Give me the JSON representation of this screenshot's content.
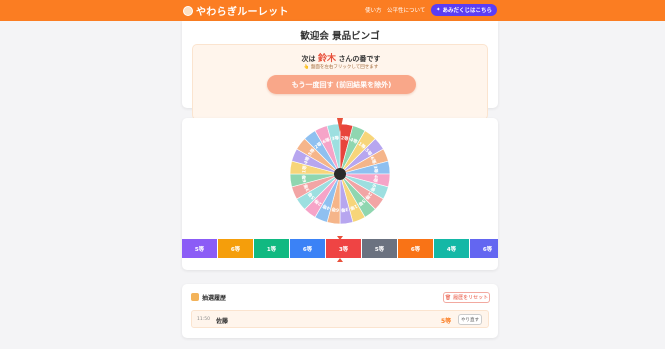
{
  "header": {
    "app_title": "やわらぎルーレット",
    "nav": [
      {
        "label": "使い方"
      },
      {
        "label": "公平性について"
      }
    ],
    "amida_label": "あみだくじはこちら",
    "colors": {
      "bar": "#fb7d22",
      "amida": "#5b3df5"
    }
  },
  "event": {
    "title": "歓迎会 景品ビンゴ",
    "turn_prefix": "次は",
    "turn_name": "鈴木",
    "turn_suffix": "さんの番です",
    "hint": "👆 盤面を左右フリックして回せます",
    "respin_label": "もう一度回す (前回結果を除外)"
  },
  "wheel": {
    "segments": [
      {
        "label": "2等",
        "color": "#f2a5a5"
      },
      {
        "label": "4等",
        "color": "#8fd6b0"
      },
      {
        "label": "1等",
        "color": "#f7d57a"
      },
      {
        "label": "5等",
        "color": "#b7a6ef"
      },
      {
        "label": "6等",
        "color": "#f5b58a"
      },
      {
        "label": "3等",
        "color": "#8fc0f0"
      },
      {
        "label": "4等",
        "color": "#f6a4c8"
      },
      {
        "label": "6等",
        "color": "#9ddfe0"
      },
      {
        "label": "2等",
        "color": "#f2a5a5"
      },
      {
        "label": "5等",
        "color": "#8fd6b0"
      },
      {
        "label": "1等",
        "color": "#f7d57a"
      },
      {
        "label": "3等",
        "color": "#b7a6ef"
      },
      {
        "label": "6等",
        "color": "#f5b58a"
      },
      {
        "label": "4等",
        "color": "#8fc0f0"
      },
      {
        "label": "2等",
        "color": "#f6a4c8"
      },
      {
        "label": "5等",
        "color": "#9ddfe0"
      },
      {
        "label": "3等",
        "color": "#f2a5a5"
      },
      {
        "label": "6等",
        "color": "#8fd6b0"
      },
      {
        "label": "1等",
        "color": "#f7d57a"
      },
      {
        "label": "4等",
        "color": "#b7a6ef"
      },
      {
        "label": "5等",
        "color": "#f5b58a"
      },
      {
        "label": "2等",
        "color": "#8fc0f0"
      },
      {
        "label": "6等",
        "color": "#f6a4c8"
      },
      {
        "label": "3等",
        "color": "#9ddfe0"
      }
    ],
    "selected_label": "3等",
    "selected_color": "#e8453c",
    "pointer_color": "#e8503a"
  },
  "strip": {
    "tiles": [
      {
        "label": "5等",
        "color": "#8b5cf6"
      },
      {
        "label": "6等",
        "color": "#f59e0b"
      },
      {
        "label": "1等",
        "color": "#10b981"
      },
      {
        "label": "6等",
        "color": "#3b82f6"
      },
      {
        "label": "3等",
        "color": "#ef4444"
      },
      {
        "label": "5等",
        "color": "#6b7280"
      },
      {
        "label": "6等",
        "color": "#f97316"
      },
      {
        "label": "4等",
        "color": "#14b8a6"
      },
      {
        "label": "6等",
        "color": "#6366f1"
      }
    ]
  },
  "history": {
    "title": "抽選履歴",
    "reset_label": "履歴をリセット",
    "rows": [
      {
        "time": "11:50",
        "name": "佐藤",
        "prize": "5等",
        "undo": "やり直す"
      }
    ]
  }
}
